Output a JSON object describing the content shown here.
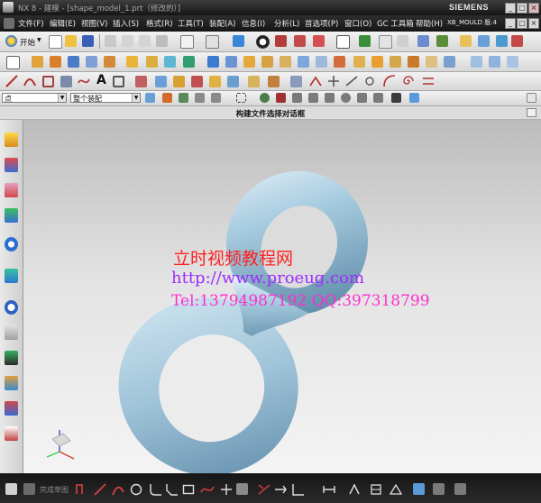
{
  "titlebar": {
    "title": "NX 8 - 建模 - [shape_model_1.prt（修改的）]",
    "brand": "SIEMENS",
    "controls": [
      "_",
      "□",
      "×"
    ]
  },
  "menubar": {
    "items": [
      "文件(F)",
      "编辑(E)",
      "视图(V)",
      "插入(S)",
      "格式(R)",
      "工具(T)",
      "装配(A)",
      "信息(I)",
      "分析(L)",
      "首选项(P)",
      "窗口(O)",
      "GC 工具箱",
      "帮助(H)",
      "XB_MOULD 版.4"
    ],
    "controls": [
      "_",
      "□",
      "×"
    ]
  },
  "toolbar_standard": {
    "start_label": "开始"
  },
  "selection_bar": {
    "filter_value": "点",
    "scope_value": "整个装配"
  },
  "dialog": {
    "title": "构建文件选择对话框"
  },
  "viewport": {
    "model_color": "#a4c8dc",
    "background_top": "#bcbcbc",
    "background_bottom": "#f4f4f4"
  },
  "watermark": {
    "title": "立时视频教程网",
    "url": "http://www.proeug.com",
    "contact": "Tel:13794987192  QQ:397318799"
  },
  "bottombar": {
    "sketch_label": "完成草图"
  }
}
